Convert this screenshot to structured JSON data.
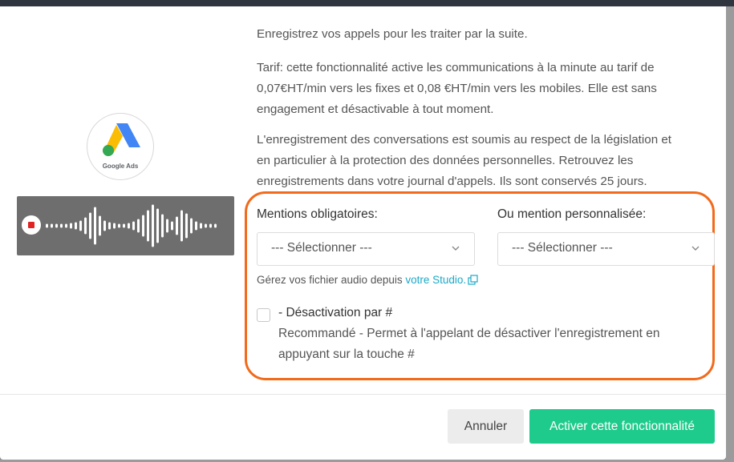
{
  "intro": "Enregistrez vos appels pour les traiter par la suite.",
  "tarif_lines": [
    "Tarif: cette fonctionnalité active les communications à la minute au tarif de",
    "0,07€HT/min vers les fixes et 0,08 €HT/min vers les mobiles. Elle est sans",
    "engagement et désactivable à tout moment."
  ],
  "legal_lines": [
    "L'enregistrement des conversations est soumis au respect de la législation et",
    "en particulier à la protection des données personnelles. Retrouvez les",
    "enregistrements dans votre journal d'appels. Ils sont conservés 25 jours."
  ],
  "logo": {
    "label": "Google Ads",
    "icon": "google-ads-icon"
  },
  "audio": {
    "icon": "record-stop-icon"
  },
  "mentions": {
    "label": "Mentions obligatoires:",
    "selected": "--- Sélectionner ---"
  },
  "personalized": {
    "label": "Ou mention personnalisée:",
    "selected": "--- Sélectionner ---"
  },
  "studio": {
    "text": "Gérez vos fichier audio depuis ",
    "link": "votre Studio."
  },
  "deactivation": {
    "checked": false,
    "title": "- Désactivation par #",
    "desc_lines": [
      "Recommandé - Permet à l'appelant de désactiver l'enregistrement en",
      "appuyant sur la touche #"
    ]
  },
  "footer": {
    "cancel": "Annuler",
    "activate": "Activer cette fonctionnalité"
  },
  "colors": {
    "accent_green": "#1ecb8c",
    "highlight_orange": "#f26a1b",
    "link_blue": "#1ba9c7"
  }
}
